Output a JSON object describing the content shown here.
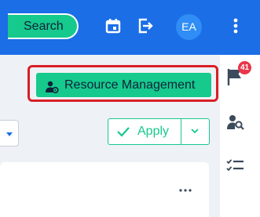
{
  "header": {
    "search_label": "Search",
    "icons": [
      "calendar-icon",
      "export-icon",
      "more-vertical-icon"
    ],
    "avatar_initials": "EA"
  },
  "toolbar": {
    "resource_management_label": "Resource Management",
    "resource_management_icon": "user-settings-icon",
    "apply_label": "Apply"
  },
  "sidebar": {
    "notification_count": "41",
    "icons": [
      "flag-icon",
      "user-search-icon",
      "checklist-icon"
    ]
  },
  "colors": {
    "topbar": "#1b6ee6",
    "accent_green": "#16c98d",
    "highlight_red": "#d81f26",
    "badge_red": "#e8364b"
  }
}
